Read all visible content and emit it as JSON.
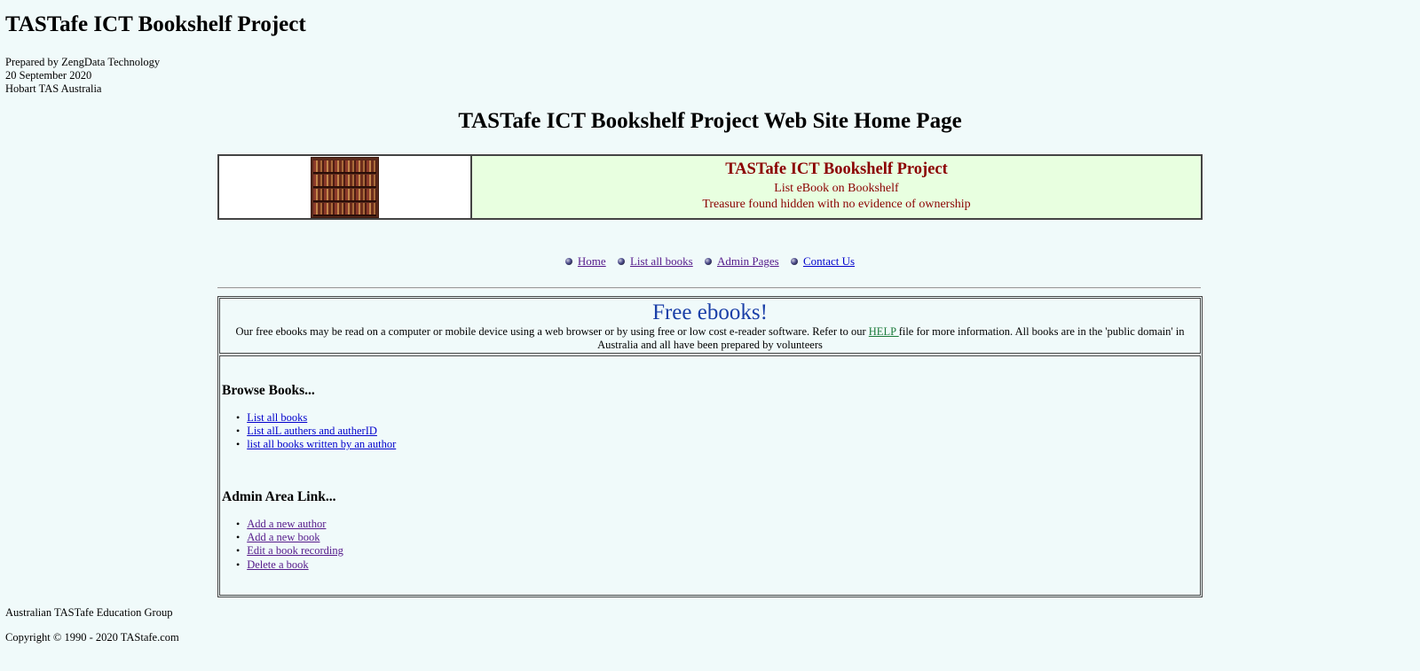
{
  "site": {
    "title": "TASTafe ICT Bookshelf Project",
    "prepared_by": "Prepared by ZengData Technology",
    "date": "20 September 2020",
    "location": "Hobart TAS Australia"
  },
  "home_title": "TASTafe ICT Bookshelf Project Web Site Home Page",
  "banner": {
    "image_icon": "bookshelf-image",
    "title": "TASTafe ICT Bookshelf Project",
    "line1": "List eBook on Bookshelf",
    "line2": "Treasure found hidden with no evidence of ownership",
    "bg_color": "#e8ffe0",
    "text_color": "#8b0000"
  },
  "nav": {
    "items": [
      {
        "label": "Home"
      },
      {
        "label": "List all books"
      },
      {
        "label": "Admin Pages"
      },
      {
        "label": "Contact Us"
      }
    ]
  },
  "free_ebooks": {
    "title": "Free ebooks!",
    "text_before": "Our free ebooks may be read on a computer or mobile device using a web browser or by using free or low cost e-reader software. Refer to our ",
    "help_link": "HELP ",
    "text_after": "file for more information. All books are in the 'public domain' in Australia and all have been prepared by volunteers"
  },
  "browse": {
    "heading": "Browse Books...",
    "links": [
      {
        "label": "List all books"
      },
      {
        "label": "List alL authers and autherID"
      },
      {
        "label": "list all books written by an author"
      }
    ]
  },
  "admin": {
    "heading": "Admin Area Link...",
    "links": [
      {
        "label": "Add a new author"
      },
      {
        "label": "Add a new book"
      },
      {
        "label": "Edit a book recording"
      },
      {
        "label": "Delete a book"
      }
    ]
  },
  "footer": {
    "org": "Australian TASTafe Education Group",
    "copyright": "Copyright © 1990 - 2020 TAStafe.com"
  }
}
